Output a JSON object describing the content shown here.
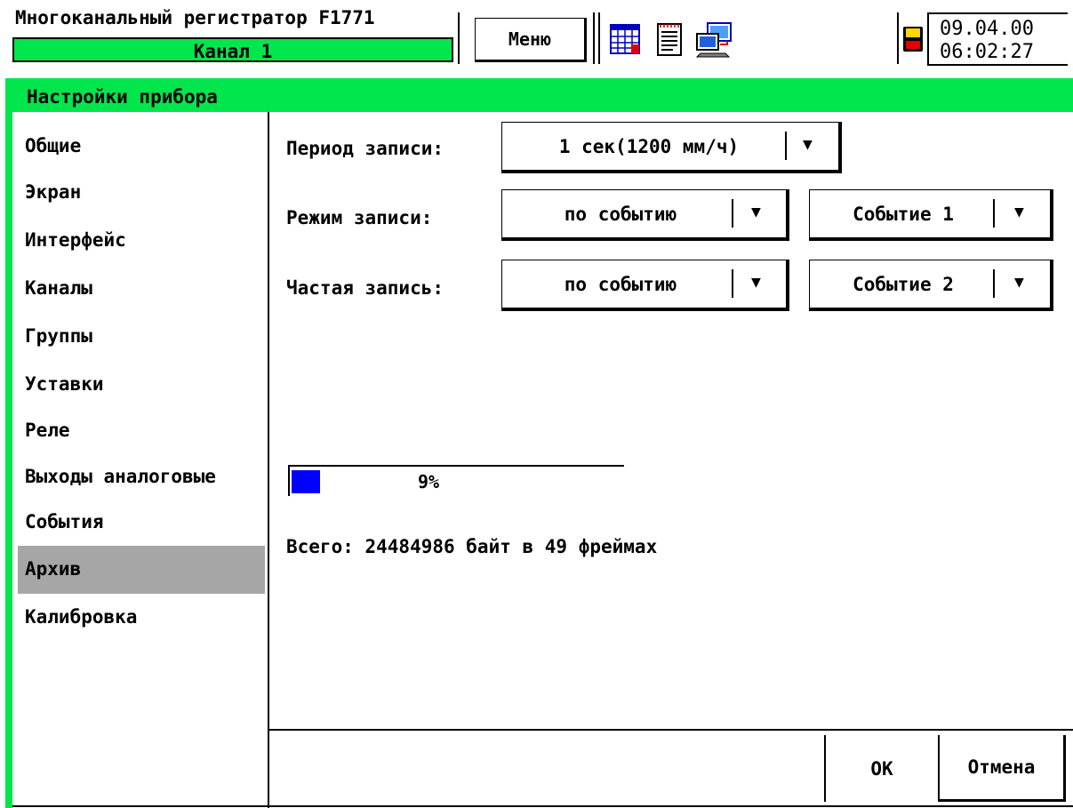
{
  "header": {
    "title": "Многоканальный регистратор F1771",
    "channel": "Канал 1",
    "menu_label": "Меню",
    "date": "09.04.00",
    "time": "06:02:27",
    "icons": [
      "table-grid-icon",
      "document-icon",
      "network-transfer-icon",
      "floppy-disk-icon"
    ]
  },
  "window": {
    "title": "Настройки прибора"
  },
  "sidebar": {
    "items": [
      {
        "label": "Общие"
      },
      {
        "label": "Экран"
      },
      {
        "label": "Интерфейс"
      },
      {
        "label": "Каналы"
      },
      {
        "label": "Группы"
      },
      {
        "label": "Уставки"
      },
      {
        "label": "Реле"
      },
      {
        "label": "Выходы аналоговые"
      },
      {
        "label": "События"
      },
      {
        "label": "Архив"
      },
      {
        "label": "Калибровка"
      }
    ],
    "active": "Архив"
  },
  "form": {
    "period_label": "Период записи:",
    "period_value": "1 сек(1200 мм/ч)",
    "mode_label": "Режим записи:",
    "mode_value": "по событию",
    "mode_event": "Событие 1",
    "frequent_label": "Частая запись:",
    "frequent_value": "по событию",
    "frequent_event": "Событие 2"
  },
  "archive": {
    "progress_percent": 9,
    "progress_text": "9%",
    "total_text": "Всего: 24484986 байт в 49 фреймах"
  },
  "footer": {
    "ok_label": "ОК",
    "cancel_label": "Отмена"
  },
  "colors": {
    "accent_green": "#00e64c",
    "selection_gray": "#a6a6a6",
    "progress_blue": "#0000ff"
  }
}
